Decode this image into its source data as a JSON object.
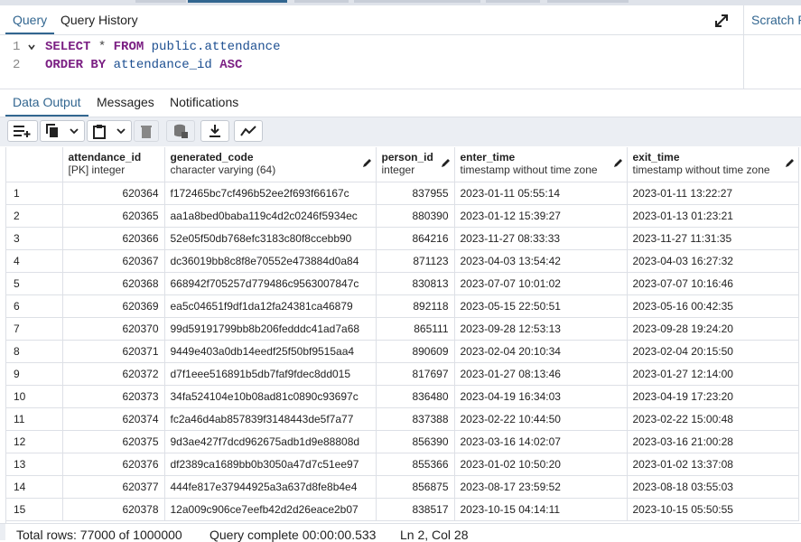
{
  "query_tabs": {
    "query": "Query",
    "history": "Query History"
  },
  "scratch_pad": {
    "title": "Scratch Pad"
  },
  "editor": {
    "lines": [
      {
        "number": "1",
        "tokens": [
          {
            "t": "SELECT",
            "c": "kw"
          },
          {
            "t": " * ",
            "c": "op"
          },
          {
            "t": "FROM",
            "c": "kw"
          },
          {
            "t": " public.attendance",
            "c": "ident"
          }
        ]
      },
      {
        "number": "2",
        "tokens": [
          {
            "t": "ORDER BY",
            "c": "kw"
          },
          {
            "t": " attendance_id ",
            "c": "ident"
          },
          {
            "t": "ASC",
            "c": "kw"
          }
        ]
      }
    ]
  },
  "result_tabs": {
    "data_output": "Data Output",
    "messages": "Messages",
    "notifications": "Notifications"
  },
  "toolbar": {
    "icons": [
      "add-row-icon",
      "copy-icon",
      "dropdown-icon",
      "paste-icon",
      "dropdown-icon",
      "delete-icon",
      "save-data-icon",
      "download-icon",
      "graph-icon"
    ]
  },
  "columns": [
    {
      "name": "attendance_id",
      "type": "[PK] integer"
    },
    {
      "name": "generated_code",
      "type": "character varying (64)"
    },
    {
      "name": "person_id",
      "type": "integer"
    },
    {
      "name": "enter_time",
      "type": "timestamp without time zone"
    },
    {
      "name": "exit_time",
      "type": "timestamp without time zone"
    }
  ],
  "rows": [
    [
      "1",
      "620364",
      "f172465bc7cf496b52ee2f693f66167c",
      "837955",
      "2023-01-11 05:55:14",
      "2023-01-11 13:22:27"
    ],
    [
      "2",
      "620365",
      "aa1a8bed0baba119c4d2c0246f5934ec",
      "880390",
      "2023-01-12 15:39:27",
      "2023-01-13 01:23:21"
    ],
    [
      "3",
      "620366",
      "52e05f50db768efc3183c80f8ccebb90",
      "864216",
      "2023-11-27 08:33:33",
      "2023-11-27 11:31:35"
    ],
    [
      "4",
      "620367",
      "dc36019bb8c8f8e70552e473884d0a84",
      "871123",
      "2023-04-03 13:54:42",
      "2023-04-03 16:27:32"
    ],
    [
      "5",
      "620368",
      "668942f705257d779486c9563007847c",
      "830813",
      "2023-07-07 10:01:02",
      "2023-07-07 10:16:46"
    ],
    [
      "6",
      "620369",
      "ea5c04651f9df1da12fa24381ca46879",
      "892118",
      "2023-05-15 22:50:51",
      "2023-05-16 00:42:35"
    ],
    [
      "7",
      "620370",
      "99d59191799bb8b206fedddc41ad7a68",
      "865111",
      "2023-09-28 12:53:13",
      "2023-09-28 19:24:20"
    ],
    [
      "8",
      "620371",
      "9449e403a0db14eedf25f50bf9515aa4",
      "890609",
      "2023-02-04 20:10:34",
      "2023-02-04 20:15:50"
    ],
    [
      "9",
      "620372",
      "d7f1eee516891b5db7faf9fdec8dd015",
      "817697",
      "2023-01-27 08:13:46",
      "2023-01-27 12:14:00"
    ],
    [
      "10",
      "620373",
      "34fa524104e10b08ad81c0890c93697c",
      "836480",
      "2023-04-19 16:34:03",
      "2023-04-19 17:23:20"
    ],
    [
      "11",
      "620374",
      "fc2a46d4ab857839f3148443de5f7a77",
      "837388",
      "2023-02-22 10:44:50",
      "2023-02-22 15:00:48"
    ],
    [
      "12",
      "620375",
      "9d3ae427f7dcd962675adb1d9e88808d",
      "856390",
      "2023-03-16 14:02:07",
      "2023-03-16 21:00:28"
    ],
    [
      "13",
      "620376",
      "df2389ca1689bb0b3050a47d7c51ee97",
      "855366",
      "2023-01-02 10:50:20",
      "2023-01-02 13:37:08"
    ],
    [
      "14",
      "620377",
      "444fe817e37944925a3a637d8fe8b4e4",
      "856875",
      "2023-08-17 23:59:52",
      "2023-08-18 03:55:03"
    ],
    [
      "15",
      "620378",
      "12a009c906ce7eefb42d2d26eace2b07",
      "838517",
      "2023-10-15 04:14:11",
      "2023-10-15 05:50:55"
    ]
  ],
  "status": {
    "total_rows": "Total rows: 77000 of 1000000",
    "query_complete": "Query complete 00:00:00.533",
    "cursor": "Ln 2, Col 28"
  }
}
